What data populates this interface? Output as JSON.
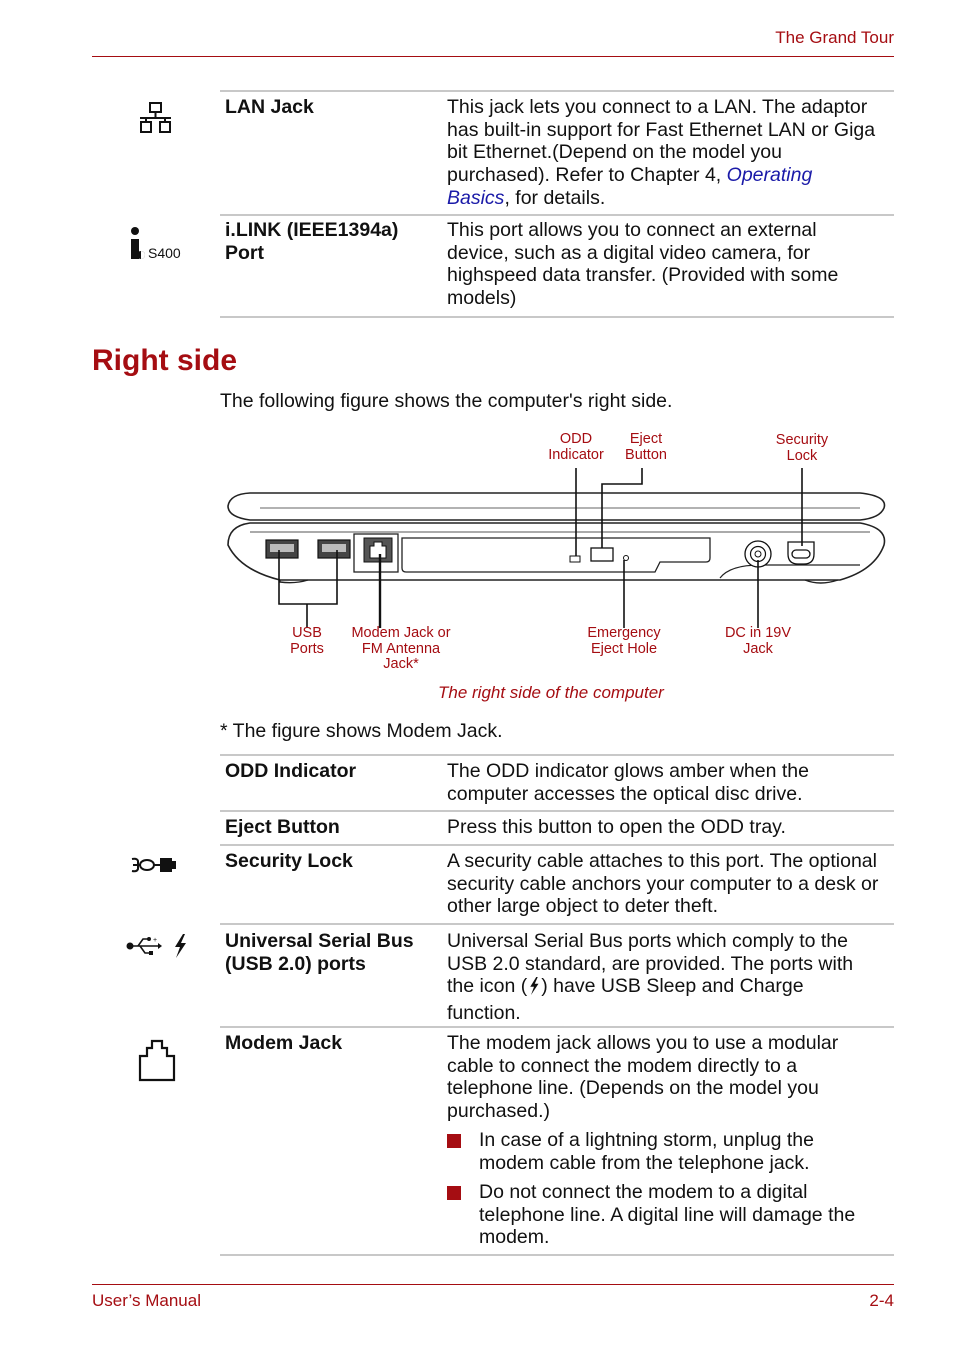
{
  "header": {
    "title": "The Grand Tour"
  },
  "top_table": [
    {
      "icon": "lan-icon",
      "term": "LAN Jack",
      "desc_lines": [
        "This jack lets you connect to a LAN. The adaptor",
        "has built-in support for Fast Ethernet LAN or Giga",
        "bit Ethernet.(Depend on the model you",
        "purchased). Refer to Chapter 4, "
      ],
      "link_part1": "Operating",
      "link_part2": "Basics",
      "desc_tail": ", for details."
    },
    {
      "icon": "ilink-icon",
      "icon_label": "S400",
      "term_lines": [
        "i.LINK (IEEE1394a)",
        "Port"
      ],
      "desc_lines": [
        "This port allows you to connect an external",
        "device, such as a digital video camera, for",
        "highspeed data transfer. (Provided with some",
        "models)"
      ]
    }
  ],
  "section": {
    "title": "Right side",
    "intro": "The following figure shows the computer's right side."
  },
  "figure": {
    "labels": {
      "odd_indicator": [
        "ODD",
        "Indicator"
      ],
      "eject_button": [
        "Eject",
        "Button"
      ],
      "security_lock": [
        "Security",
        "Lock"
      ],
      "usb_ports": [
        "USB",
        "Ports"
      ],
      "modem_jack": [
        "Modem Jack or",
        "FM Antenna",
        "Jack*"
      ],
      "emergency_eject": [
        "Emergency",
        "Eject Hole"
      ],
      "dc_in": [
        "DC in 19V",
        "Jack"
      ]
    },
    "caption": "The right side of the computer",
    "footnote": "* The figure shows Modem Jack."
  },
  "bottom_table": [
    {
      "term": "ODD Indicator",
      "desc_lines": [
        "The ODD indicator glows amber when the",
        "computer accesses the optical disc drive."
      ]
    },
    {
      "term": "Eject Button",
      "desc_lines": [
        "Press this button to open the ODD tray."
      ]
    },
    {
      "icon": "security-lock-icon",
      "term": "Security Lock",
      "desc_lines": [
        "A security cable attaches to this port. The optional",
        "security cable anchors your computer to a desk or",
        "other large object to deter theft."
      ]
    },
    {
      "icon": "usb-icon",
      "term_lines": [
        "Universal Serial Bus",
        "(USB 2.0) ports"
      ],
      "desc_lines": [
        "Universal Serial Bus ports which comply to the",
        "USB 2.0 standard, are provided. The ports with",
        "the icon (",
        ") have USB Sleep and Charge",
        "function."
      ]
    },
    {
      "icon": "modem-icon",
      "term": "Modem Jack",
      "desc_lines": [
        "The modem jack allows you to use a modular",
        "cable to connect the modem directly to a",
        "telephone line. (Depends on the model you",
        "purchased.)"
      ],
      "bullets": [
        [
          "In case of a lightning storm, unplug the",
          "modem cable from the telephone jack."
        ],
        [
          "Do not connect the modem to a digital",
          "telephone line. A digital line will damage the",
          "modem."
        ]
      ]
    }
  ],
  "footer": {
    "left": "User’s Manual",
    "right": "2-4"
  },
  "colors": {
    "accent": "#a50d12",
    "link": "#1a1aa8",
    "rule": "#c8c8c8"
  }
}
